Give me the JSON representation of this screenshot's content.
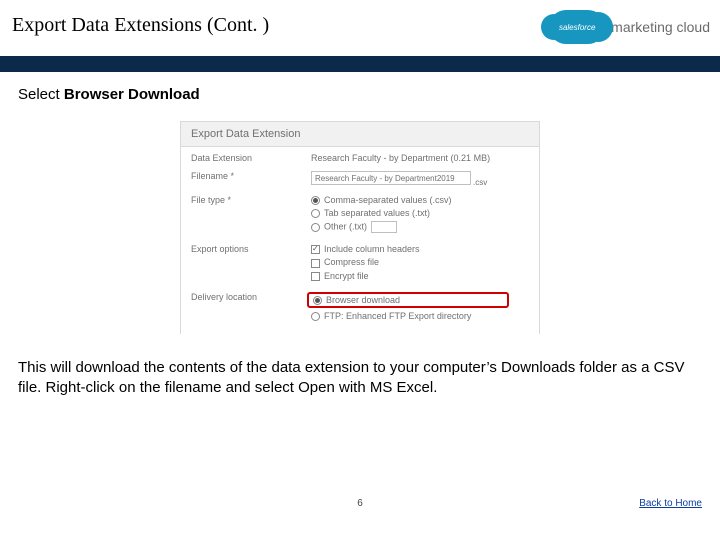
{
  "header": {
    "title": "Export Data Extensions (Cont. )",
    "logo_salesforce": "salesforce",
    "logo_marketing_cloud": "marketing cloud"
  },
  "instruction": {
    "prefix": "Select ",
    "bold": "Browser Download"
  },
  "dialog": {
    "title": "Export Data Extension",
    "fields": {
      "data_extension_label": "Data Extension",
      "data_extension_value": "Research Faculty - by Department (0.21 MB)",
      "filename_label": "Filename *",
      "filename_value": "Research Faculty - by Department2019",
      "filename_ext": ".csv",
      "file_type_label": "File type *",
      "file_type_options": {
        "csv": "Comma-separated values (.csv)",
        "txt": "Tab separated values (.txt)",
        "other": "Other (.txt)"
      },
      "export_options_label": "Export options",
      "export_options": {
        "headers": "Include column headers",
        "compress": "Compress file",
        "encrypt": "Encrypt file"
      },
      "delivery_label": "Delivery location",
      "delivery_options": {
        "browser": "Browser download",
        "ftp": "FTP: Enhanced FTP Export directory"
      }
    }
  },
  "description": "This will download the contents of the data extension to your computer’s Downloads folder as a CSV file.  Right-click on the filename and select Open with MS Excel.",
  "footer": {
    "page_number": "6",
    "back_link": "Back to Home"
  }
}
